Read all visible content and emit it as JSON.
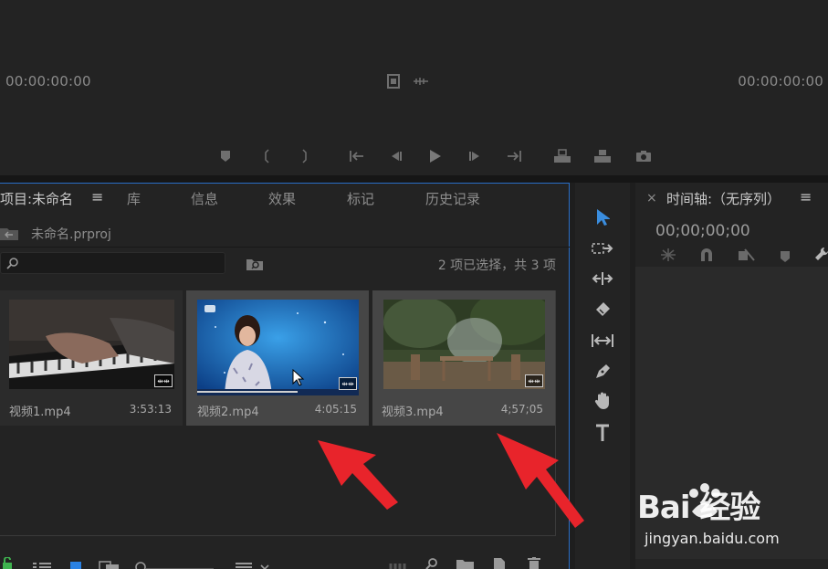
{
  "monitor": {
    "timecode_left": "00:00:00:00",
    "timecode_right": "00:00:00:00"
  },
  "project": {
    "tabs": [
      {
        "label": "项目:未命名"
      },
      {
        "label": "库"
      },
      {
        "label": "信息"
      },
      {
        "label": "效果"
      },
      {
        "label": "标记"
      },
      {
        "label": "历史记录"
      }
    ],
    "menu_glyph": "≡",
    "file_name": "未命名.prproj",
    "search_placeholder": "",
    "selection_status": "2 项已选择，共 3 项",
    "clips": [
      {
        "name": "视频1.mp4",
        "duration": "3:53:13",
        "selected": false
      },
      {
        "name": "视频2.mp4",
        "duration": "4:05:15",
        "selected": true
      },
      {
        "name": "视频3.mp4",
        "duration": "4;57;05",
        "selected": true
      }
    ]
  },
  "timeline": {
    "title": "时间轴:（无序列）",
    "timecode": "00;00;00;00",
    "menu_glyph": "≡",
    "close_glyph": "×"
  },
  "watermark": {
    "logo_text": "Bai 经验",
    "url": "jingyan.baidu.com"
  },
  "colors": {
    "accent": "#2a6fc7",
    "arrow": "#e8242b",
    "selection_tool": "#3a8dde"
  }
}
